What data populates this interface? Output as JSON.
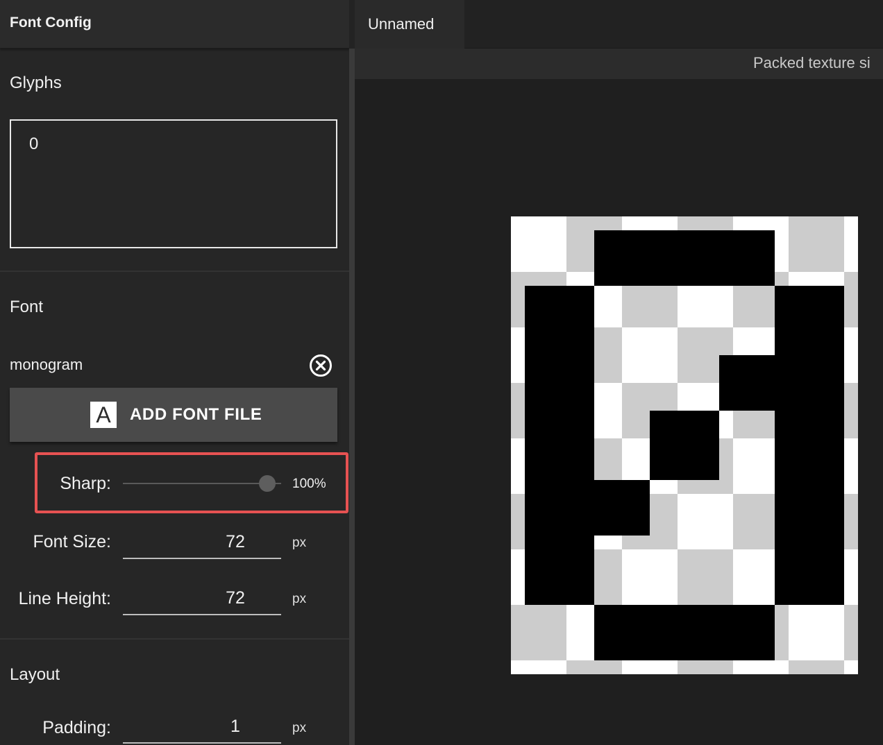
{
  "panel": {
    "title": "Font Config"
  },
  "glyphs": {
    "section_title": "Glyphs",
    "value": "0"
  },
  "font": {
    "section_title": "Font",
    "name": "monogram",
    "add_button_icon": "A",
    "add_button_label": "ADD FONT FILE",
    "sharp_label": "Sharp:",
    "sharp_value": "100%",
    "sharp_level": 1.0,
    "font_size_label": "Font Size:",
    "font_size_value": "72",
    "font_size_unit": "px",
    "line_height_label": "Line Height:",
    "line_height_value": "72",
    "line_height_unit": "px"
  },
  "layout": {
    "section_title": "Layout",
    "padding_label": "Padding:",
    "padding_value": "1",
    "padding_unit": "px"
  },
  "tabs": [
    {
      "label": "Unnamed"
    }
  ],
  "info": {
    "text": "Packed texture si"
  },
  "colors": {
    "highlight": "#e65252",
    "panel_bg": "#262626",
    "button_bg": "#4a4a4a"
  },
  "icons": {
    "remove_font": "close-circle-icon",
    "add_font": "font-letter-a-icon"
  }
}
